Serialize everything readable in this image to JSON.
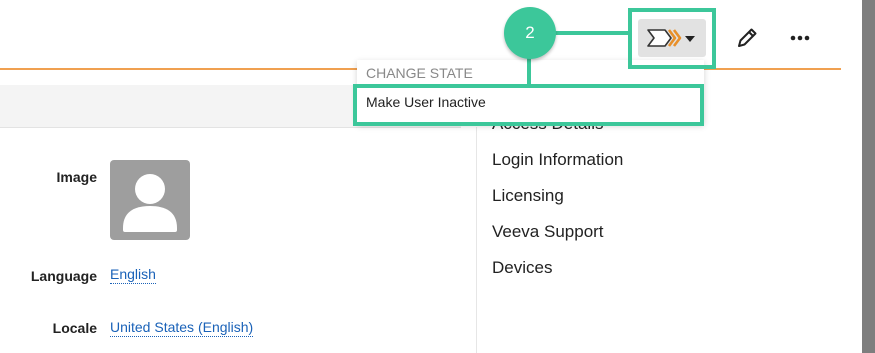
{
  "header": {
    "callout_number": "2",
    "icons": {
      "state": "chevron-state-icon",
      "caret": "caret-down-icon",
      "edit": "pencil-icon",
      "more": "more-dots-icon"
    }
  },
  "state_menu": {
    "header": "CHANGE STATE",
    "items": [
      {
        "label": "Make User Inactive"
      }
    ]
  },
  "profile": {
    "fields": [
      {
        "label": "Image",
        "value": ""
      },
      {
        "label": "Language",
        "value": "English"
      },
      {
        "label": "Locale",
        "value": "United States (English)"
      }
    ]
  },
  "side_nav": {
    "items": [
      {
        "label": "Access Details"
      },
      {
        "label": "Login Information"
      },
      {
        "label": "Licensing"
      },
      {
        "label": "Veeva Support"
      },
      {
        "label": "Devices"
      }
    ]
  },
  "colors": {
    "accent_orange": "#f0a050",
    "callout_green": "#3cc79a",
    "link_blue": "#1a62b8"
  }
}
